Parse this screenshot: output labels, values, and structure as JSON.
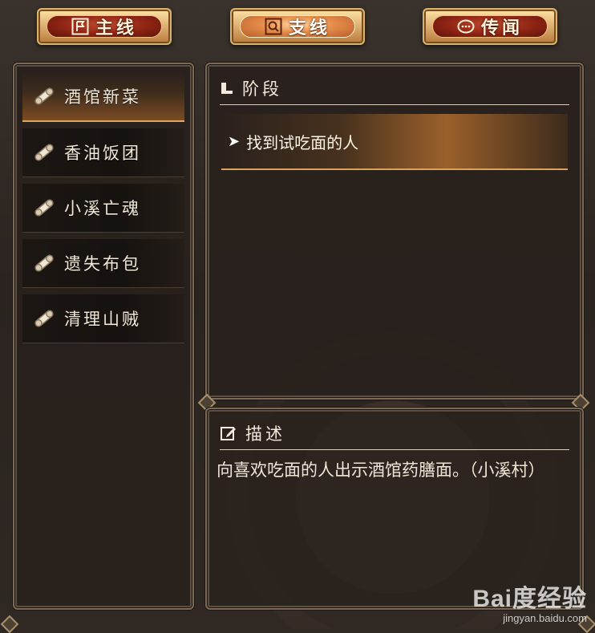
{
  "tabs": [
    {
      "label": "主线",
      "icon": "flag-icon",
      "active": false
    },
    {
      "label": "支线",
      "icon": "search-icon",
      "active": true
    },
    {
      "label": "传闻",
      "icon": "chat-bubble-icon",
      "active": false
    }
  ],
  "quests": [
    {
      "label": "酒馆新菜",
      "selected": true
    },
    {
      "label": "香油饭团",
      "selected": false
    },
    {
      "label": "小溪亡魂",
      "selected": false
    },
    {
      "label": "遗失布包",
      "selected": false
    },
    {
      "label": "清理山贼",
      "selected": false
    }
  ],
  "stage": {
    "title": "阶段",
    "current": "找到试吃面的人"
  },
  "description": {
    "title": "描述",
    "text": "向喜欢吃面的人出示酒馆药膳面。（小溪村）"
  },
  "watermark": {
    "brand": "Bai度经验",
    "site": "jingyan.baidu.com"
  },
  "colors": {
    "accent_gold": "#d9a25d",
    "tab_red": "#8e2414",
    "tab_orange_active": "#e58d4b"
  }
}
